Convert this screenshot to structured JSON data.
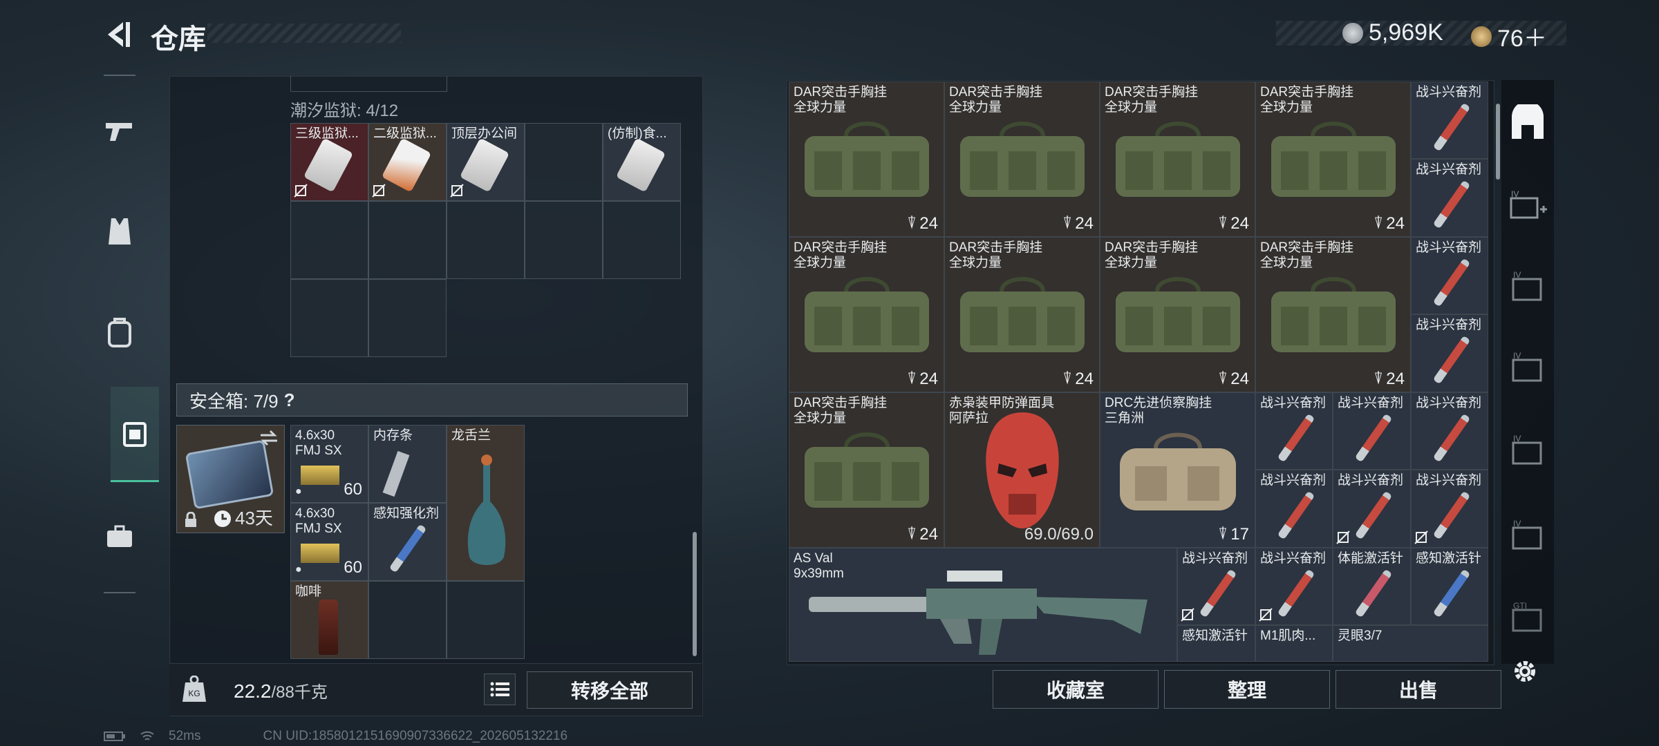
{
  "header": {
    "title": "仓库"
  },
  "currency": {
    "primary": "5,969K",
    "secondary": "76＋"
  },
  "left": {
    "section_title": "潮汐监狱: 4/12",
    "items": [
      {
        "label": "三级监狱..."
      },
      {
        "label": "二级监狱..."
      },
      {
        "label": "顶层办公间"
      },
      {
        "label": ""
      },
      {
        "label": "(仿制)食..."
      }
    ],
    "safe_label": "安全箱: 7/9",
    "safe_help": "?",
    "safe_case_time": "43天",
    "safe_items": [
      {
        "label": "4.6x30 FMJ SX",
        "count": "60"
      },
      {
        "label": "内存条"
      },
      {
        "label": "龙舌兰"
      },
      {
        "label": "4.6x30 FMJ SX",
        "count": "60"
      },
      {
        "label": "感知强化剂"
      },
      {
        "label": "咖啡"
      }
    ],
    "weight_current": "22.2",
    "weight_total": "/88千克",
    "transfer_all": "转移全部"
  },
  "right": {
    "bag_line1": "DAR突击手胸挂",
    "bag_line2": "全球力量",
    "bag_count": "24",
    "stim": "战斗兴奋剂",
    "mask_line1": "赤枭装甲防弹面具",
    "mask_line2": "阿萨拉",
    "mask_durability": "69.0/69.0",
    "drc_line1": "DRC先进侦察胸挂",
    "drc_line2": "三角洲",
    "drc_count": "17",
    "gun_line1": "AS Val",
    "gun_line2": "9x39mm",
    "physical_stim": "体能激活针",
    "perception_stim": "感知激活针",
    "m1": "M1肌肉...",
    "eye": "灵眼3/7"
  },
  "buttons": {
    "collection": "收藏室",
    "sort": "整理",
    "sell": "出售"
  },
  "status": {
    "ping": "52ms",
    "uid": "CN UID:1858012151690907336622_202605132216"
  }
}
